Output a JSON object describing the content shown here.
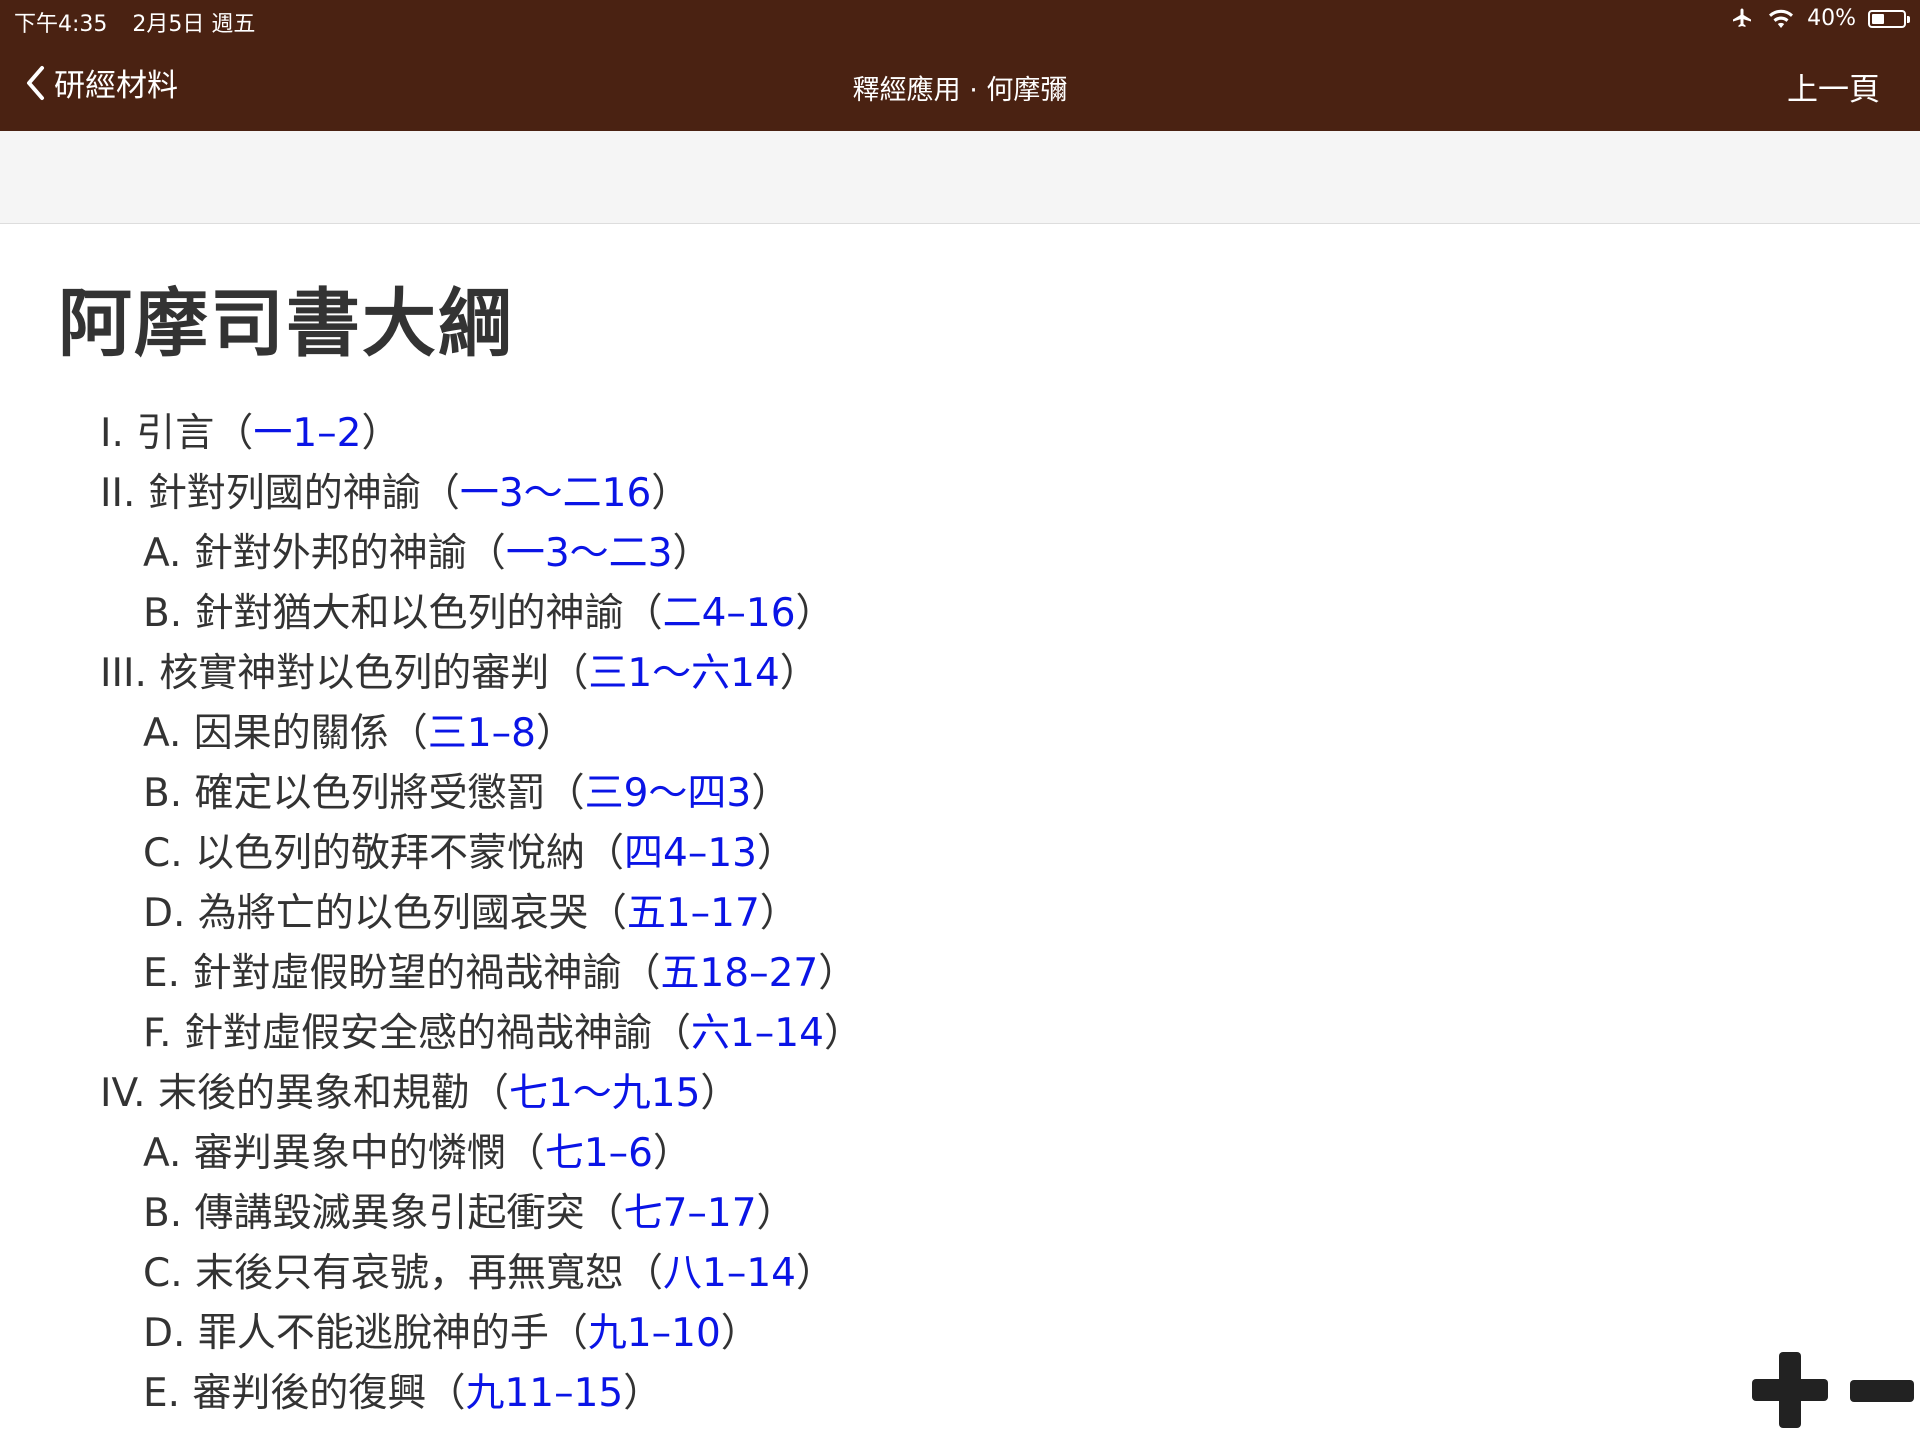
{
  "status_bar": {
    "time": "下午4:35",
    "date": "2月5日 週五",
    "battery": "40%",
    "battery_level": 0.4,
    "icons": [
      "airplane-icon",
      "wifi-icon",
      "battery-icon"
    ]
  },
  "nav": {
    "back_label": "研經材料",
    "title": "釋經應用 · 何摩彌",
    "prev_label": "上一頁"
  },
  "document": {
    "title": "阿摩司書大綱",
    "outline": [
      {
        "level": 1,
        "text": "I. 引言",
        "open": "（",
        "ref": "一1–2",
        "close": "）"
      },
      {
        "level": 1,
        "text": "II. 針對列國的神諭",
        "open": "（",
        "ref": "一3～二16",
        "close": "）"
      },
      {
        "level": 2,
        "text": "A. 針對外邦的神諭",
        "open": "（",
        "ref": "一3～二3",
        "close": "）"
      },
      {
        "level": 2,
        "text": "B. 針對猶大和以色列的神諭",
        "open": "（",
        "ref": "二4–16",
        "close": "）"
      },
      {
        "level": 1,
        "text": "III. 核實神對以色列的審判",
        "open": "（",
        "ref": "三1～六14",
        "close": "）"
      },
      {
        "level": 2,
        "text": "A. 因果的關係",
        "open": "（",
        "ref": "三1–8",
        "close": "）"
      },
      {
        "level": 2,
        "text": "B. 確定以色列將受懲罰",
        "open": "（",
        "ref": "三9～四3",
        "close": "）"
      },
      {
        "level": 2,
        "text": "C. 以色列的敬拜不蒙悅納",
        "open": "（",
        "ref": "四4–13",
        "close": "）"
      },
      {
        "level": 2,
        "text": "D. 為將亡的以色列國哀哭",
        "open": "（",
        "ref": "五1–17",
        "close": "）"
      },
      {
        "level": 2,
        "text": "E. 針對虛假盼望的禍哉神諭",
        "open": "（",
        "ref": "五18–27",
        "close": "）"
      },
      {
        "level": 2,
        "text": "F. 針對虛假安全感的禍哉神諭",
        "open": "（",
        "ref": "六1–14",
        "close": "）"
      },
      {
        "level": 1,
        "text": "IV. 末後的異象和規勸",
        "open": "（",
        "ref": "七1～九15",
        "close": "）"
      },
      {
        "level": 2,
        "text": "A. 審判異象中的憐憫",
        "open": "（",
        "ref": "七1–6",
        "close": "）"
      },
      {
        "level": 2,
        "text": "B. 傳講毀滅異象引起衝突",
        "open": "（",
        "ref": "七7–17",
        "close": "）"
      },
      {
        "level": 2,
        "text": "C. 末後只有哀號，再無寬恕",
        "open": "（",
        "ref": "八1–14",
        "close": "）"
      },
      {
        "level": 2,
        "text": "D. 罪人不能逃脫神的手",
        "open": "（",
        "ref": "九1–10",
        "close": "）"
      },
      {
        "level": 2,
        "text": "E. 審判後的復興",
        "open": "（",
        "ref": "九11–15",
        "close": "）"
      }
    ]
  },
  "zoom": {
    "icons": [
      "plus-icon",
      "minus-icon"
    ]
  },
  "colors": {
    "bar": "#4a2212",
    "link": "#0a14e6",
    "text": "#333333",
    "toolbar": "#f5f5f5"
  }
}
